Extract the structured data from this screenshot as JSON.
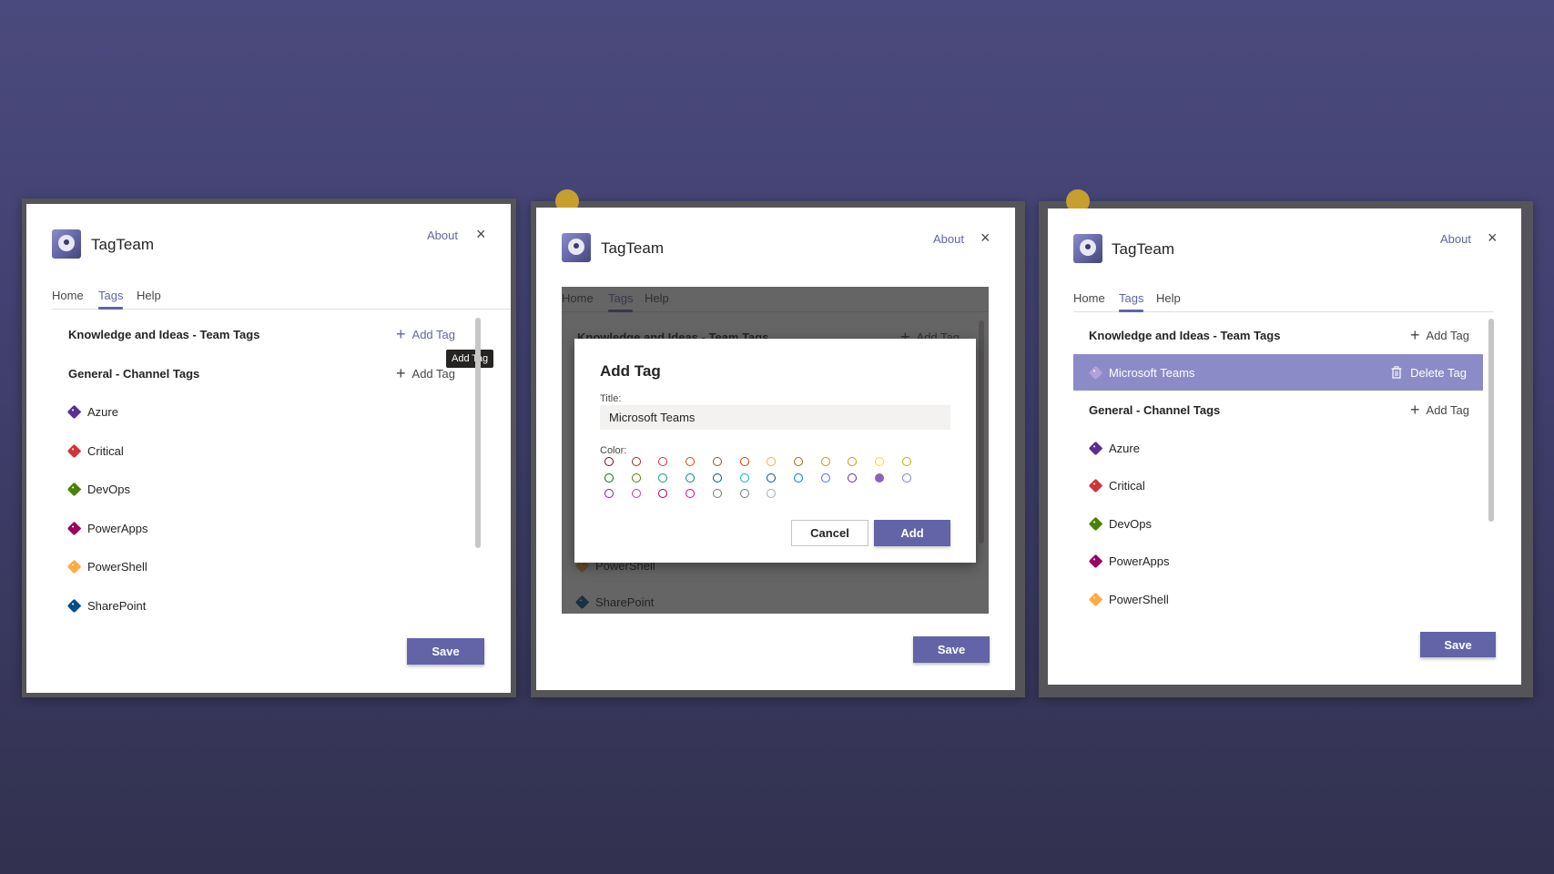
{
  "app": {
    "name": "TagTeam",
    "about": "About",
    "close_icon": "×"
  },
  "tabs": [
    "Home",
    "Tags",
    "Help"
  ],
  "sections": {
    "team": "Knowledge and Ideas - Team Tags",
    "channel": "General - Channel Tags"
  },
  "actions": {
    "add_tag": "Add Tag",
    "delete_tag": "Delete Tag",
    "save": "Save",
    "plus": "+"
  },
  "tags": [
    {
      "name": "Azure",
      "color": "#5c2e91"
    },
    {
      "name": "Critical",
      "color": "#d13438"
    },
    {
      "name": "DevOps",
      "color": "#498205"
    },
    {
      "name": "PowerApps",
      "color": "#9b0062"
    },
    {
      "name": "PowerShell",
      "color": "#ffaa44"
    },
    {
      "name": "SharePoint",
      "color": "#004e8c"
    }
  ],
  "panel1": {
    "tooltip": "Add Tag"
  },
  "panel2": {
    "dialog": {
      "title": "Add Tag",
      "title_label": "Title:",
      "title_value": "Microsoft Teams",
      "color_label": "Color:",
      "cancel": "Cancel",
      "add": "Add",
      "selected_color": "#8764b8"
    },
    "colors": [
      [
        "#750b1c",
        "#a4262c",
        "#d13438",
        "#ca5010",
        "#8e562e",
        "#da3b01",
        "#ffaa44",
        "#986f0b",
        "#c19c00",
        "#c19c00",
        "#fce100",
        "#b5b500"
      ],
      [
        "#0b6a0b",
        "#498205",
        "#00a36c",
        "#038387",
        "#005b70",
        "#00b7c3",
        "#004e8c",
        "#0078d4",
        "#4f6bed",
        "#5c2e91",
        "#8764b8",
        "#8378de"
      ],
      [
        "#881798",
        "#c239b3",
        "#9b0062",
        "#e3008c",
        "#7a7574",
        "#69797e",
        "#a0aeb2"
      ]
    ]
  },
  "panel3": {
    "new_tag": {
      "name": "Microsoft Teams",
      "color": "#b4a0dc"
    }
  }
}
